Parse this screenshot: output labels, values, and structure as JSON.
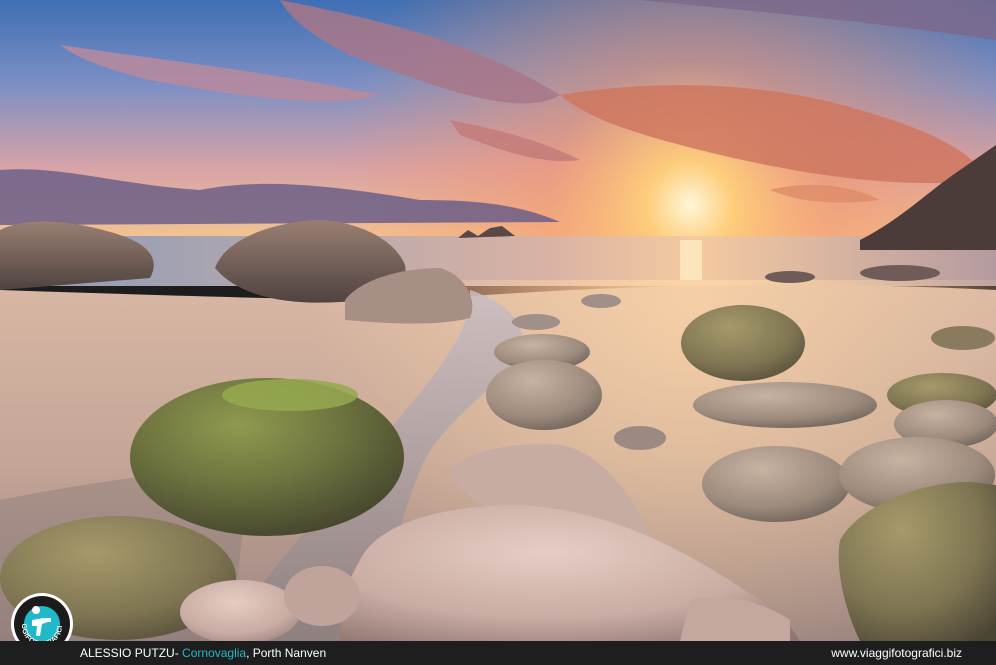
{
  "caption": {
    "author": "ALESSIO PUTZU",
    "separator": "- ",
    "region": "Cornovaglia",
    "place": ", Porth Nanven",
    "website": "www.viaggifotografici.biz"
  },
  "logo": {
    "icon": "photographer-silhouette-icon",
    "text": "VIAGGIFOTOGRAFICI.BIZ"
  },
  "colors": {
    "accent": "#1fb9c9",
    "bar": "#1e1e1e"
  }
}
